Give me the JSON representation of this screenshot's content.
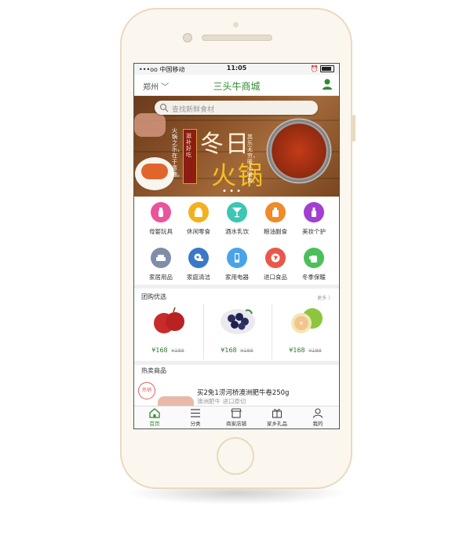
{
  "status_bar": {
    "carrier": "•••oo 中国移动",
    "time": "11:05"
  },
  "header": {
    "city": "郑州",
    "title": "三头牛商城"
  },
  "search": {
    "placeholder": "查找新鲜食材"
  },
  "banner": {
    "headline_top": "冬日",
    "headline_bottom": "火锅",
    "side_text_left": "滋补好吃",
    "side_text_mid": "火锅之乐，在于意趣。",
    "side_text_right": "其乐无穷，暖心暖胃。"
  },
  "categories": [
    {
      "label": "母婴玩具",
      "icon": "baby-bottle-icon",
      "color": "#e8559a"
    },
    {
      "label": "休闲零食",
      "icon": "snack-icon",
      "color": "#f3b11e"
    },
    {
      "label": "酒水乳饮",
      "icon": "cocktail-icon",
      "color": "#3cc6b4"
    },
    {
      "label": "粮油副食",
      "icon": "oil-bottle-icon",
      "color": "#f08a2a"
    },
    {
      "label": "美妆个护",
      "icon": "lotion-icon",
      "color": "#a23fd1"
    },
    {
      "label": "家居用品",
      "icon": "sofa-icon",
      "color": "#7f8ea8"
    },
    {
      "label": "家庭清洁",
      "icon": "tissue-roll-icon",
      "color": "#3b78c7"
    },
    {
      "label": "家用电器",
      "icon": "phone-icon",
      "color": "#4aa3e8"
    },
    {
      "label": "进口食品",
      "icon": "globe-icon",
      "color": "#e8584a"
    },
    {
      "label": "冬季保暖",
      "icon": "glove-icon",
      "color": "#4cbf5a"
    }
  ],
  "group_buy": {
    "title": "团购优选",
    "more": "更多 〉",
    "items": [
      {
        "fruit": "apple-image",
        "price": "¥168",
        "old_price": "¥188"
      },
      {
        "fruit": "blueberry-image",
        "price": "¥168",
        "old_price": "¥188"
      },
      {
        "fruit": "pomelo-image",
        "price": "¥168",
        "old_price": "¥188"
      }
    ]
  },
  "hot_sale": {
    "title": "热卖商品",
    "badge": "热销",
    "product_name": "买2免1涝河桥澳洲肥牛卷250g",
    "product_sub": "澳洲肥牛 进口原切"
  },
  "tabbar": [
    {
      "label": "首页",
      "icon": "home-icon",
      "active": true
    },
    {
      "label": "分类",
      "icon": "list-icon",
      "active": false
    },
    {
      "label": "商家店铺",
      "icon": "store-icon",
      "active": false
    },
    {
      "label": "家乡礼品",
      "icon": "gift-icon",
      "active": false
    },
    {
      "label": "我的",
      "icon": "user-icon",
      "active": false
    }
  ],
  "colors": {
    "brand_green": "#2f8a2f",
    "phone_body": "#fbf7ef",
    "phone_trim": "#ead9bf"
  }
}
